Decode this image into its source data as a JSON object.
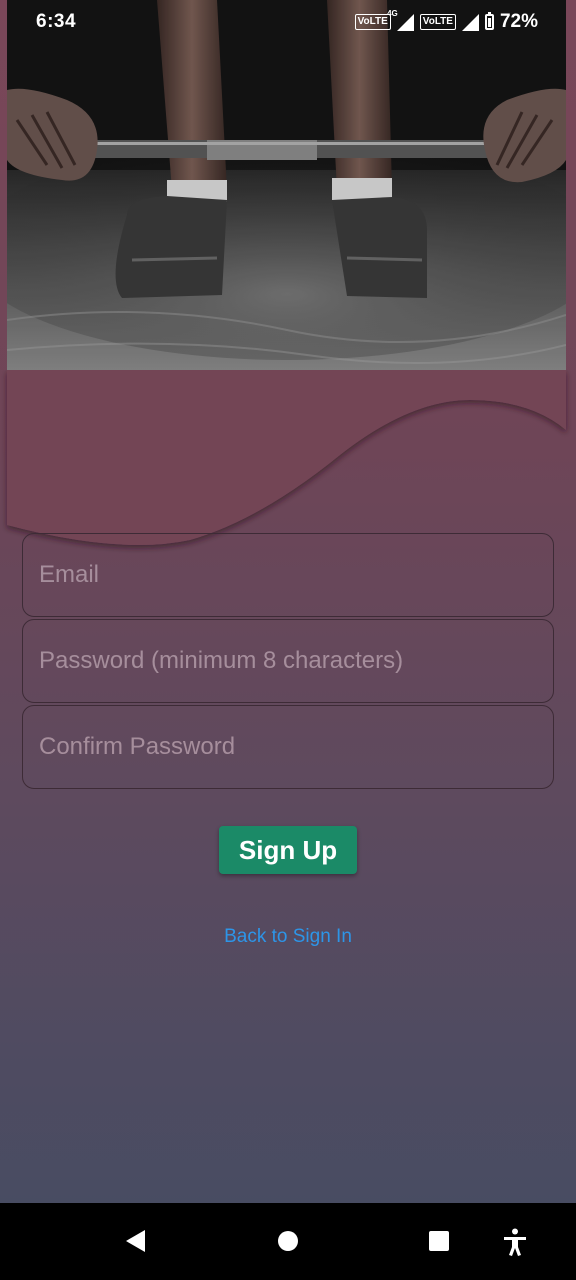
{
  "status_bar": {
    "time": "6:34",
    "network_label_1": "VoLTE",
    "network_gen": "4G",
    "network_label_2": "VoLTE",
    "battery": "72%"
  },
  "hero": {
    "icon": "barbell-deadlift-photo"
  },
  "form": {
    "email_placeholder": "Email",
    "password_placeholder": "Password (minimum 8 characters)",
    "confirm_placeholder": "Confirm Password",
    "submit_label": "Sign Up",
    "back_link": "Back to Sign In"
  },
  "colors": {
    "submit": "#1b8a67",
    "link": "#2d95e8",
    "background_top": "#7a4759",
    "background_bottom": "#454c62"
  },
  "nav_bar": {
    "icons": [
      "back-icon",
      "home-icon",
      "recents-icon",
      "accessibility-icon"
    ]
  }
}
